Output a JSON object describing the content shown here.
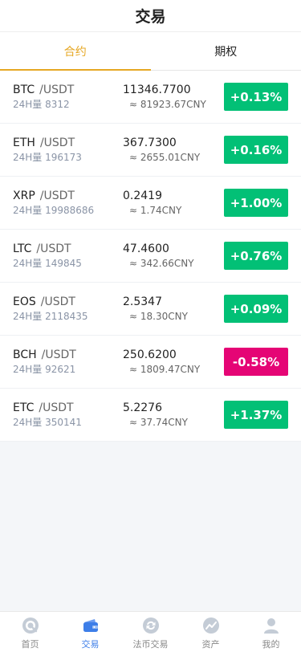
{
  "header": {
    "title": "交易"
  },
  "tabs": [
    {
      "label": "合约",
      "active": true
    },
    {
      "label": "期权",
      "active": false
    }
  ],
  "markets": [
    {
      "base": "BTC",
      "quote": "/USDT",
      "volume": "24H量 8312",
      "price": "11346.7700",
      "cny": "≈ 81923.67CNY",
      "change": "+0.13%",
      "direction": "up"
    },
    {
      "base": "ETH",
      "quote": "/USDT",
      "volume": "24H量 196173",
      "price": "367.7300",
      "cny": "≈ 2655.01CNY",
      "change": "+0.16%",
      "direction": "up"
    },
    {
      "base": "XRP",
      "quote": "/USDT",
      "volume": "24H量 19988686",
      "price": "0.2419",
      "cny": "≈ 1.74CNY",
      "change": "+1.00%",
      "direction": "up"
    },
    {
      "base": "LTC",
      "quote": "/USDT",
      "volume": "24H量 149845",
      "price": "47.4600",
      "cny": "≈ 342.66CNY",
      "change": "+0.76%",
      "direction": "up"
    },
    {
      "base": "EOS",
      "quote": "/USDT",
      "volume": "24H量 2118435",
      "price": "2.5347",
      "cny": "≈ 18.30CNY",
      "change": "+0.09%",
      "direction": "up"
    },
    {
      "base": "BCH",
      "quote": "/USDT",
      "volume": "24H量 92621",
      "price": "250.6200",
      "cny": "≈ 1809.47CNY",
      "change": "-0.58%",
      "direction": "down"
    },
    {
      "base": "ETC",
      "quote": "/USDT",
      "volume": "24H量 350141",
      "price": "5.2276",
      "cny": "≈ 37.74CNY",
      "change": "+1.37%",
      "direction": "up"
    }
  ],
  "nav": [
    {
      "label": "首页",
      "icon": "home-icon",
      "active": false
    },
    {
      "label": "交易",
      "icon": "wallet-icon",
      "active": true
    },
    {
      "label": "法币交易",
      "icon": "exchange-icon",
      "active": false
    },
    {
      "label": "资产",
      "icon": "chart-trend-icon",
      "active": false
    },
    {
      "label": "我的",
      "icon": "user-icon",
      "active": false
    }
  ],
  "colors": {
    "accent": "#e6a723",
    "up": "#02c076",
    "down": "#e50575",
    "nav_active": "#3d7ee8",
    "nav_inactive": "#bcc4cf"
  }
}
